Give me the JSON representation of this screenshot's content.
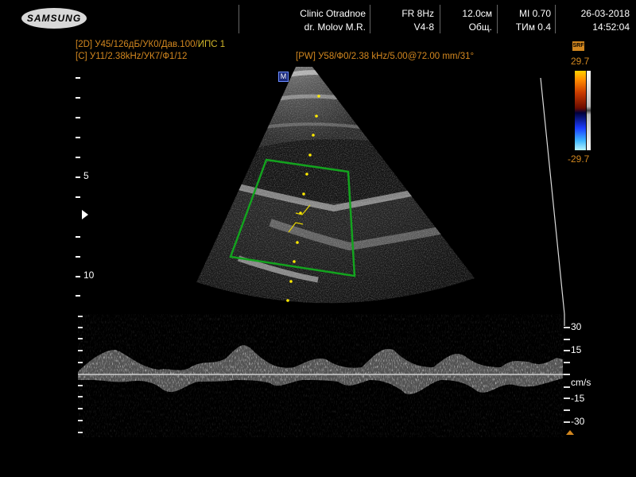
{
  "header": {
    "logo": "SAMSUNG",
    "clinic": "Clinic  Otradnoe",
    "doctor": "dr. Molov M.R.",
    "frame_rate": "FR 8Hz",
    "probe": "V4-8",
    "depth": "12.0см",
    "preset": "Общ.",
    "mi": "MI  0.70",
    "tim": "TИм 0.4",
    "date": "26-03-2018",
    "time": "14:52:04"
  },
  "params": {
    "line_2d": [
      "[2D]",
      " У45/126дБ/УК0/Дав.100/",
      "ИПС 1"
    ],
    "line_c": [
      "[C]",
      " У11/2.38kHz/УК7/Ф1/12"
    ],
    "line_pw": [
      "[PW]",
      " У58/Ф0/2.38 kHz/5.00@72.00 mm/31°"
    ]
  },
  "depth_scale": {
    "label_5": "5",
    "label_10": "10"
  },
  "marker": "M",
  "colorbar": {
    "top_label": "29.7",
    "bottom_label": "-29.7",
    "badge": "SRF"
  },
  "velocity_scale": {
    "labels": [
      "30",
      "15",
      "cm/s",
      "-15",
      "-30"
    ]
  }
}
